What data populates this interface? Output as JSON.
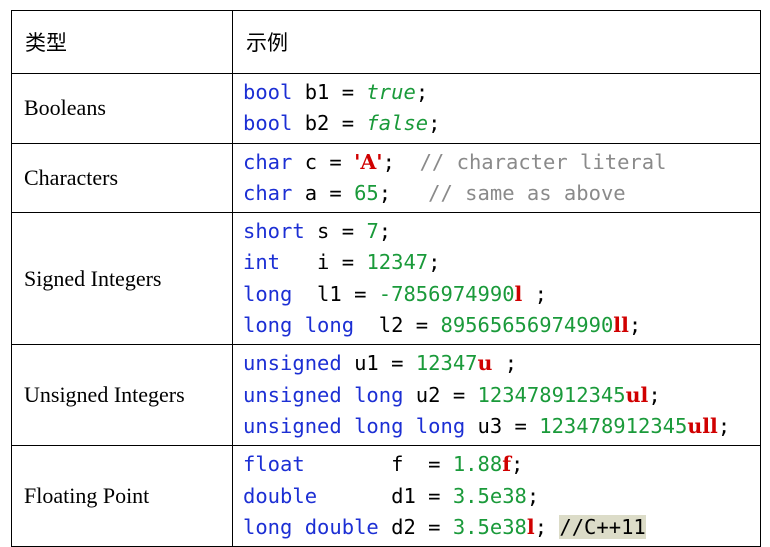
{
  "header": {
    "type_label": "类型",
    "example_label": "示例"
  },
  "rows": [
    {
      "type": "Booleans",
      "lines": [
        [
          {
            "c": "kw",
            "t": "bool"
          },
          {
            "c": "",
            "t": " b1 = "
          },
          {
            "c": "lit",
            "t": "true"
          },
          {
            "c": "",
            "t": ";"
          }
        ],
        [
          {
            "c": "kw",
            "t": "bool"
          },
          {
            "c": "",
            "t": " b2 = "
          },
          {
            "c": "lit",
            "t": "false"
          },
          {
            "c": "",
            "t": ";"
          }
        ]
      ]
    },
    {
      "type": "Characters",
      "lines": [
        [
          {
            "c": "kw",
            "t": "char"
          },
          {
            "c": "",
            "t": " c = "
          },
          {
            "c": "chr",
            "t": "'A'"
          },
          {
            "c": "",
            "t": ";  "
          },
          {
            "c": "cmt",
            "t": "// character literal"
          }
        ],
        [
          {
            "c": "kw",
            "t": "char"
          },
          {
            "c": "",
            "t": " a = "
          },
          {
            "c": "num",
            "t": "65"
          },
          {
            "c": "",
            "t": ";   "
          },
          {
            "c": "cmt",
            "t": "// same as above"
          }
        ]
      ]
    },
    {
      "type": "Signed Integers",
      "lines": [
        [
          {
            "c": "kw",
            "t": "short"
          },
          {
            "c": "",
            "t": " s = "
          },
          {
            "c": "num",
            "t": "7"
          },
          {
            "c": "",
            "t": ";"
          }
        ],
        [
          {
            "c": "kw",
            "t": "int"
          },
          {
            "c": "",
            "t": "   i = "
          },
          {
            "c": "num",
            "t": "12347"
          },
          {
            "c": "",
            "t": ";"
          }
        ],
        [
          {
            "c": "kw",
            "t": "long"
          },
          {
            "c": "",
            "t": "  l1 = "
          },
          {
            "c": "num",
            "t": "-7856974990"
          },
          {
            "c": "sfx",
            "t": "l"
          },
          {
            "c": "",
            "t": " ;"
          }
        ],
        [
          {
            "c": "kw",
            "t": "long long"
          },
          {
            "c": "",
            "t": "  l2 = "
          },
          {
            "c": "num",
            "t": "89565656974990"
          },
          {
            "c": "sfx",
            "t": "ll"
          },
          {
            "c": "",
            "t": ";"
          }
        ]
      ]
    },
    {
      "type": "Unsigned Integers",
      "lines": [
        [
          {
            "c": "kw",
            "t": "unsigned"
          },
          {
            "c": "",
            "t": " u1 = "
          },
          {
            "c": "num",
            "t": "12347"
          },
          {
            "c": "sfx",
            "t": "u"
          },
          {
            "c": "",
            "t": " ;"
          }
        ],
        [
          {
            "c": "kw",
            "t": "unsigned long"
          },
          {
            "c": "",
            "t": " u2 = "
          },
          {
            "c": "num",
            "t": "123478912345"
          },
          {
            "c": "sfx",
            "t": "ul"
          },
          {
            "c": "",
            "t": ";"
          }
        ],
        [
          {
            "c": "kw",
            "t": "unsigned long long"
          },
          {
            "c": "",
            "t": " u3 = "
          },
          {
            "c": "num",
            "t": "123478912345"
          },
          {
            "c": "sfx",
            "t": "ull"
          },
          {
            "c": "",
            "t": ";"
          }
        ]
      ]
    },
    {
      "type": "Floating Point",
      "lines": [
        [
          {
            "c": "kw",
            "t": "float"
          },
          {
            "c": "",
            "t": "       f  = "
          },
          {
            "c": "num",
            "t": "1.88"
          },
          {
            "c": "sfx",
            "t": "f"
          },
          {
            "c": "",
            "t": ";"
          }
        ],
        [
          {
            "c": "kw",
            "t": "double"
          },
          {
            "c": "",
            "t": "      d1 = "
          },
          {
            "c": "num",
            "t": "3.5e38"
          },
          {
            "c": "",
            "t": ";"
          }
        ],
        [
          {
            "c": "kw",
            "t": "long double"
          },
          {
            "c": "",
            "t": " d2 = "
          },
          {
            "c": "num",
            "t": "3.5e38"
          },
          {
            "c": "sfx",
            "t": "l"
          },
          {
            "c": "",
            "t": "; "
          },
          {
            "c": "hl",
            "t": "//C++11"
          }
        ]
      ]
    }
  ]
}
